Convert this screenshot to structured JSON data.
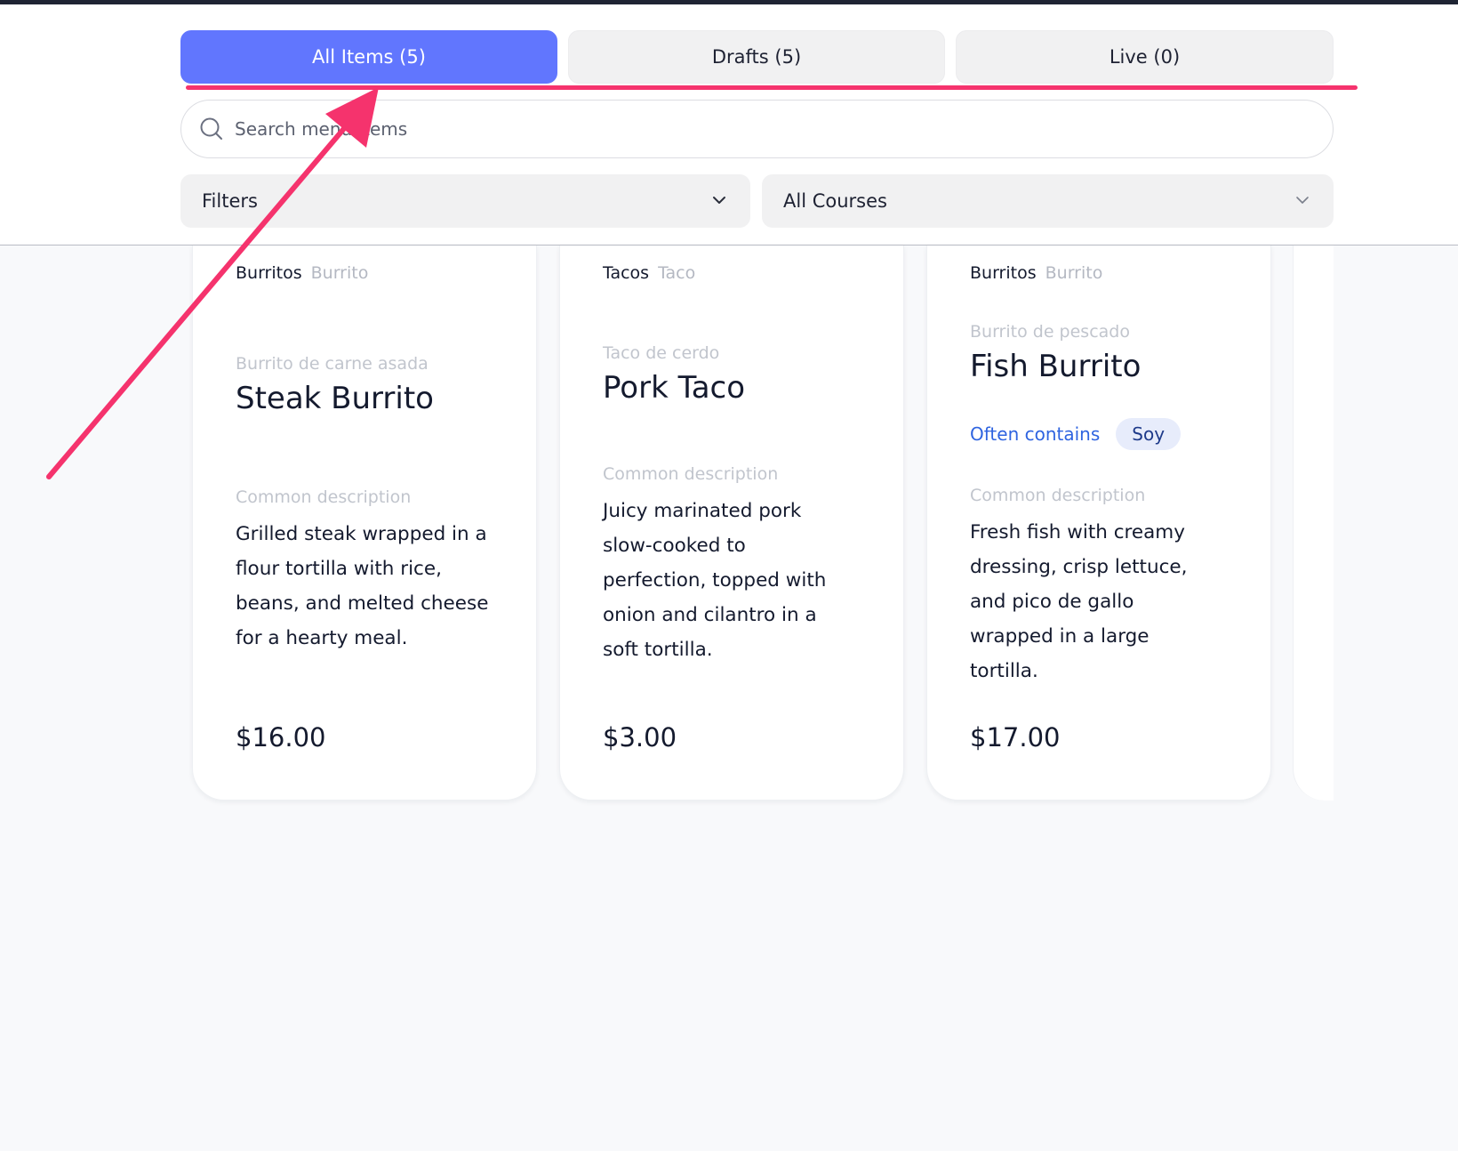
{
  "tabs": [
    {
      "label": "All Items (5)",
      "active": true
    },
    {
      "label": "Drafts (5)",
      "active": false
    },
    {
      "label": "Live (0)",
      "active": false
    }
  ],
  "search": {
    "placeholder": "Search menu items"
  },
  "filters": {
    "label": "Filters"
  },
  "courses": {
    "label": "All Courses"
  },
  "items": [
    {
      "category": "Burritos",
      "category_alt": "Burrito",
      "name_alt": "Burrito de carne asada",
      "name": "Steak Burrito",
      "desc_label": "Common description",
      "description": "Grilled steak wrapped in a flour tortilla with rice, beans, and melted cheese for a hearty meal.",
      "price": "$16.00"
    },
    {
      "category": "Tacos",
      "category_alt": "Taco",
      "name_alt": "Taco de cerdo",
      "name": "Pork Taco",
      "desc_label": "Common description",
      "description": "Juicy marinated pork slow-cooked to perfection, topped with onion and cilantro in a soft tortilla.",
      "price": "$3.00"
    },
    {
      "category": "Burritos",
      "category_alt": "Burrito",
      "name_alt": "Burrito de pescado",
      "name": "Fish Burrito",
      "allergen_label": "Often contains",
      "allergen": "Soy",
      "desc_label": "Common description",
      "description": "Fresh fish with creamy dressing, crisp lettuce, and pico de gallo wrapped in a large tortilla.",
      "price": "$17.00"
    }
  ],
  "colors": {
    "accent": "#6176fe",
    "annotation": "#f5336d",
    "allergen_text": "#2f64e0"
  },
  "icons": {
    "search": "search-icon",
    "chevron": "chevron-down-icon",
    "arrow": "annotation-arrow"
  }
}
